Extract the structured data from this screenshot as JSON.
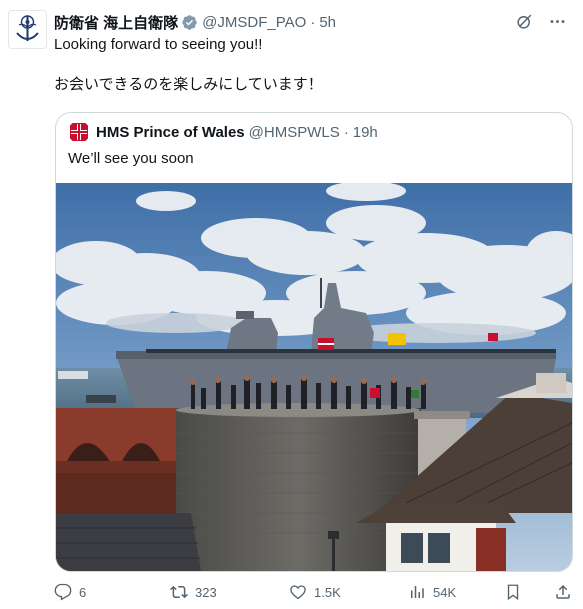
{
  "post": {
    "author_name": "防衛省 海上自衛隊",
    "author_handle": "@JMSDF_PAO",
    "separator": "·",
    "time": "5h",
    "text": "Looking forward to seeing you!!\n\nお会いできるのを楽しみにしています！"
  },
  "quote": {
    "author_name": "HMS Prince of Wales",
    "author_handle": "@HMSPWLS",
    "separator": "·",
    "time": "19h",
    "text": "We’ll see you soon"
  },
  "actions": {
    "replies": "6",
    "reposts": "323",
    "likes": "1.5K",
    "views": "54K"
  },
  "colors": {
    "text_primary": "#0f1419",
    "text_secondary": "#536471",
    "verified_badge": "#829aab",
    "border": "#cfd9de"
  },
  "icons": [
    "jmsdf-emblem-icon",
    "verified-badge-icon",
    "grok-icon",
    "more-icon",
    "royal-navy-crest-icon",
    "reply-icon",
    "repost-icon",
    "like-icon",
    "views-icon",
    "share-icon"
  ]
}
